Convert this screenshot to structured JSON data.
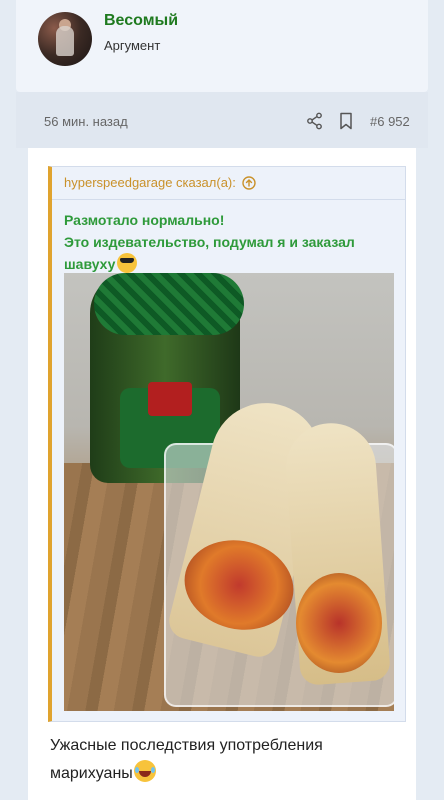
{
  "user": {
    "name": "Весомый",
    "role": "Аргумент"
  },
  "post": {
    "time": "56 мин. назад",
    "number": "#6 952",
    "text": "Ужасные последствия употребления марихуаны"
  },
  "quote": {
    "author_line": "hyperspeedgarage сказал(а):",
    "text_line1": "Размотало нормально!",
    "text_line2": "Это издевательство, подумал я и заказал шавуху"
  },
  "icons": {
    "share": "share-icon",
    "bookmark": "bookmark-icon",
    "jump_to_quote": "arrow-up-circle-icon"
  },
  "colors": {
    "username": "#1f7a1f",
    "quote_author": "#c9912a",
    "quote_text": "#2e9a3a",
    "quote_border": "#e0a32e"
  }
}
